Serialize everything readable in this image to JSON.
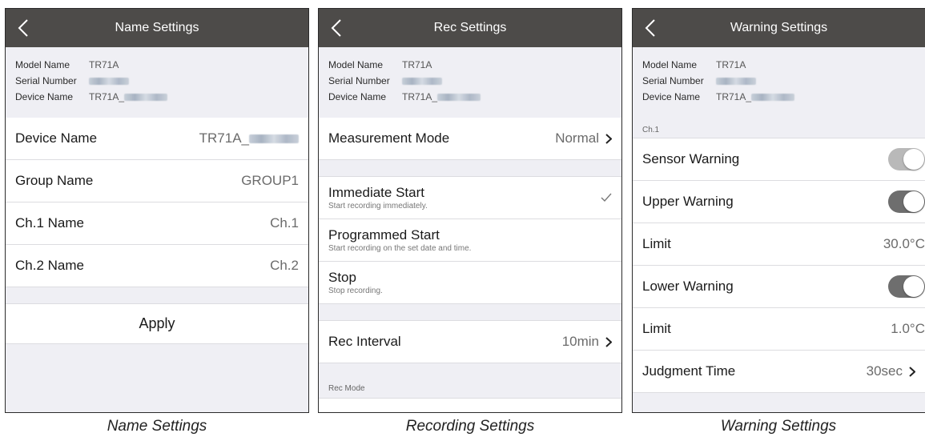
{
  "panels": {
    "name": {
      "title": "Name Settings",
      "info": [
        {
          "key": "Model Name",
          "value": "TR71A"
        },
        {
          "key": "Serial Number",
          "value": ""
        },
        {
          "key": "Device Name",
          "value": "TR71A_"
        }
      ],
      "rows": [
        {
          "label": "Device Name",
          "value": "TR71A_"
        },
        {
          "label": "Group Name",
          "value": "GROUP1"
        },
        {
          "label": "Ch.1 Name",
          "value": "Ch.1"
        },
        {
          "label": "Ch.2 Name",
          "value": "Ch.2"
        }
      ],
      "apply_label": "Apply",
      "caption": "Name Settings"
    },
    "rec": {
      "title": "Rec Settings",
      "info": [
        {
          "key": "Model Name",
          "value": "TR71A"
        },
        {
          "key": "Serial Number",
          "value": ""
        },
        {
          "key": "Device Name",
          "value": "TR71A_"
        }
      ],
      "measurement": {
        "label": "Measurement Mode",
        "value": "Normal"
      },
      "start_options": [
        {
          "title": "Immediate Start",
          "subtitle": "Start recording immediately.",
          "checked": true
        },
        {
          "title": "Programmed Start",
          "subtitle": "Start recording on the set date and time.",
          "checked": false
        },
        {
          "title": "Stop",
          "subtitle": "Stop recording.",
          "checked": false
        }
      ],
      "interval": {
        "label": "Rec Interval",
        "value": "10min"
      },
      "rec_mode_section": "Rec Mode",
      "caption": "Recording Settings"
    },
    "warning": {
      "title": "Warning Settings",
      "info": [
        {
          "key": "Model Name",
          "value": "TR71A"
        },
        {
          "key": "Serial Number",
          "value": ""
        },
        {
          "key": "Device Name",
          "value": "TR71A_"
        }
      ],
      "section": "Ch.1",
      "sensor_warning": {
        "label": "Sensor Warning",
        "on": true
      },
      "upper_warning": {
        "label": "Upper Warning",
        "on": true
      },
      "upper_limit": {
        "label": "Limit",
        "value": "30.0°C"
      },
      "lower_warning": {
        "label": "Lower Warning",
        "on": true
      },
      "lower_limit": {
        "label": "Limit",
        "value": "1.0°C"
      },
      "judgment": {
        "label": "Judgment Time",
        "value": "30sec"
      },
      "caption": "Warning Settings"
    }
  },
  "colors": {
    "navbar": "#4d4b49",
    "background": "#efeff4",
    "toggle_light": "#b9b9b9",
    "toggle_dark": "#6e6e6e"
  }
}
